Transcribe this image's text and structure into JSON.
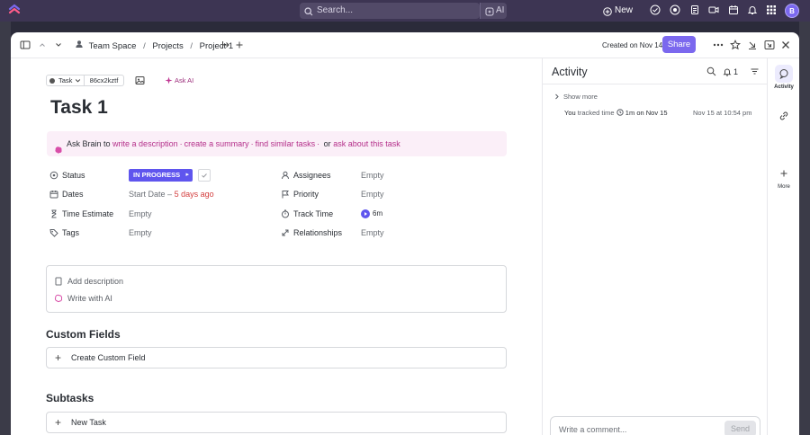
{
  "appbar": {
    "search_placeholder": "Search...",
    "ai_label": "AI",
    "new_label": "New",
    "avatar_initial": "B"
  },
  "header": {
    "breadcrumb": [
      "Team Space",
      "Projects",
      "Project 1"
    ],
    "created_label": "Created on Nov 14",
    "share_label": "Share"
  },
  "task": {
    "type_label": "Task",
    "task_id": "86cx2kztf",
    "ask_ai_label": "Ask AI",
    "title": "Task 1",
    "brain_bar": {
      "prefix": "Ask Brain to",
      "links": [
        "write a description",
        "create a summary",
        "find similar tasks"
      ],
      "or": "or",
      "last_link": "ask about this task",
      "separator": "·"
    },
    "fields": {
      "status_label": "Status",
      "status_value": "IN PROGRESS",
      "dates_label": "Dates",
      "dates_start": "Start Date",
      "dates_dash": "–",
      "dates_due": "5 days ago",
      "time_estimate_label": "Time Estimate",
      "time_estimate_value": "Empty",
      "tags_label": "Tags",
      "tags_value": "Empty",
      "assignees_label": "Assignees",
      "assignees_value": "Empty",
      "priority_label": "Priority",
      "priority_value": "Empty",
      "track_time_label": "Track Time",
      "track_time_value": "6m",
      "relationships_label": "Relationships",
      "relationships_value": "Empty"
    },
    "description": {
      "add_label": "Add description",
      "ai_label": "Write with AI"
    },
    "custom_fields": {
      "title": "Custom Fields",
      "create_label": "Create Custom Field"
    },
    "subtasks": {
      "title": "Subtasks",
      "new_label": "New Task"
    }
  },
  "activity": {
    "title": "Activity",
    "count": "1",
    "show_more": "Show more",
    "entry": {
      "prefix": "You",
      "action": "tracked time",
      "duration": "1m",
      "on": "on Nov 15"
    },
    "entry_time": "Nov 15 at 10:54 pm",
    "comment_placeholder": "Write a comment...",
    "send_label": "Send"
  },
  "rail": {
    "activity_label": "Activity",
    "more_label": "More"
  },
  "colors": {
    "accent": "#7b68ee",
    "status": "#5f55ee",
    "brain_link": "#b42f8a",
    "appbar": "#3d3553"
  }
}
